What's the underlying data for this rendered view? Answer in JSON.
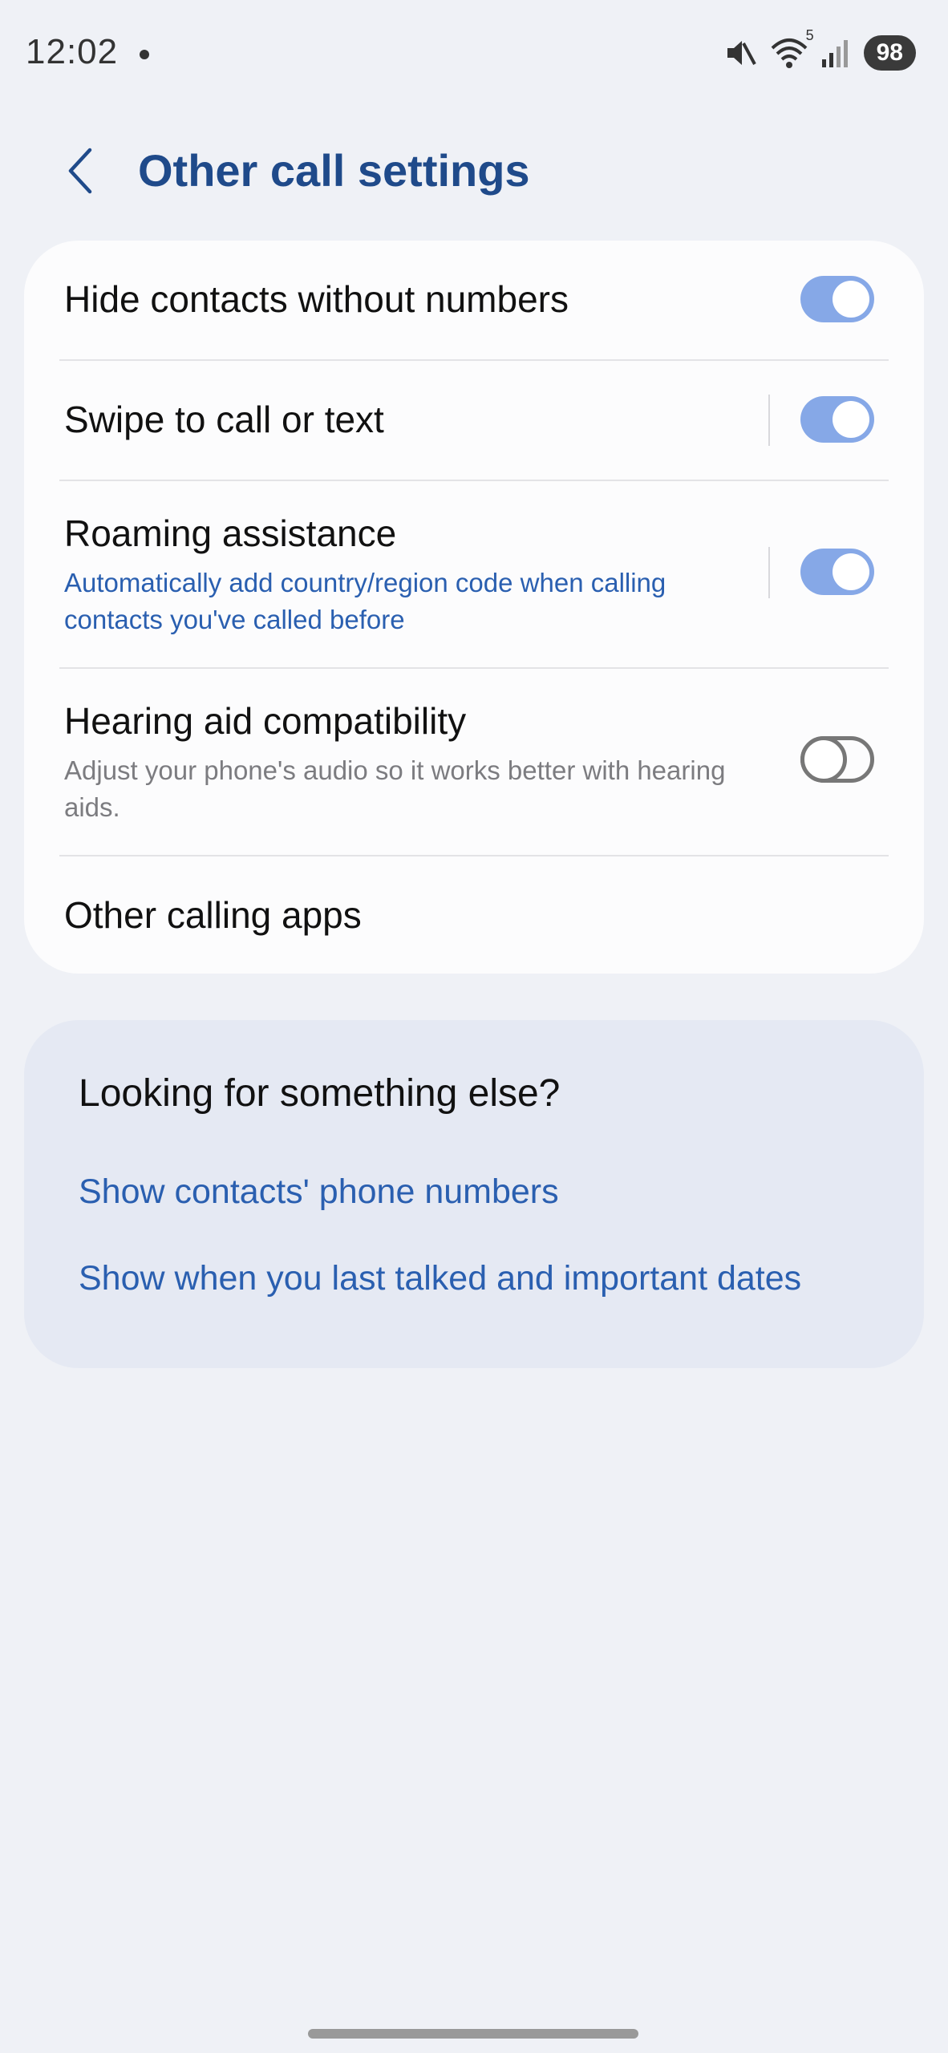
{
  "status_bar": {
    "time": "12:02",
    "battery": "98",
    "icons": [
      "mute-icon",
      "wifi-icon",
      "signal-icon"
    ],
    "wifi_badge": "5"
  },
  "header": {
    "back_icon": "chevron-left-icon",
    "title": "Other call settings"
  },
  "settings": {
    "hide_contacts": {
      "title": "Hide contacts without numbers",
      "enabled": true
    },
    "swipe": {
      "title": "Swipe to call or text",
      "enabled": true
    },
    "roaming": {
      "title": "Roaming assistance",
      "subtitle": "Automatically add country/region code when calling contacts you've called before",
      "enabled": true
    },
    "hearing": {
      "title": "Hearing aid compatibility",
      "subtitle": "Adjust your phone's audio so it works better with hearing aids.",
      "enabled": false
    },
    "other_apps": {
      "title": "Other calling apps"
    }
  },
  "suggestions": {
    "title": "Looking for something else?",
    "links": [
      "Show contacts' phone numbers",
      "Show when you last talked and important dates"
    ]
  },
  "colors": {
    "accent": "#1f4a8a",
    "link": "#2a5fb0",
    "toggle_on": "#86a8e7",
    "background": "#eff1f6"
  }
}
